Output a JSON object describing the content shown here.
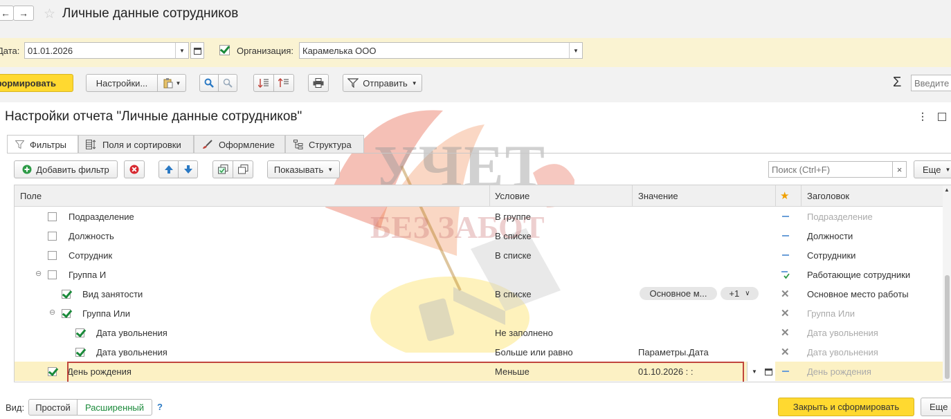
{
  "window": {
    "title": "Личные данные сотрудников"
  },
  "nav": {
    "back": "←",
    "forward": "→"
  },
  "params": {
    "date_label": "Дата:",
    "date_value": "01.01.2026",
    "org_label": "Организация:",
    "org_value": "Карамелька ООО"
  },
  "toolbar": {
    "generate_label": "Сформировать",
    "settings_label": "Настройки...",
    "send_label": "Отправить",
    "sum_symbol": "Σ",
    "input_placeholder": "Введите"
  },
  "settings": {
    "title": "Настройки отчета \"Личные данные сотрудников\"",
    "tabs": [
      {
        "label": "Фильтры"
      },
      {
        "label": "Поля и сортировки"
      },
      {
        "label": "Оформление"
      },
      {
        "label": "Структура"
      }
    ],
    "add_filter_label": "Добавить фильтр",
    "show_label": "Показывать",
    "search_placeholder": "Поиск (Ctrl+F)",
    "more_label": "Еще"
  },
  "table": {
    "headers": {
      "field": "Поле",
      "condition": "Условие",
      "value": "Значение",
      "caption": "Заголовок"
    },
    "rows": [
      {
        "field": "Подразделение",
        "condition": "В группе",
        "value": "",
        "caption": "Подразделение",
        "checked": false,
        "caption_gray": true,
        "marker": "dash"
      },
      {
        "field": "Должность",
        "condition": "В списке",
        "value": "",
        "caption": "Должности",
        "checked": false,
        "caption_gray": false,
        "marker": "dash"
      },
      {
        "field": "Сотрудник",
        "condition": "В списке",
        "value": "",
        "caption": "Сотрудники",
        "checked": false,
        "caption_gray": false,
        "marker": "dash"
      },
      {
        "field": "Группа И",
        "condition": "",
        "value": "",
        "caption": "Работающие сотрудники",
        "checked": false,
        "caption_gray": false,
        "marker": "group"
      },
      {
        "field": "Вид занятости",
        "condition": "В списке",
        "value": "Основное м...",
        "value_extra": "+1",
        "caption": "Основное место работы",
        "checked": true,
        "caption_gray": false,
        "marker": "x"
      },
      {
        "field": "Группа Или",
        "condition": "",
        "value": "",
        "caption": "Группа Или",
        "checked": true,
        "caption_gray": true,
        "marker": "x"
      },
      {
        "field": "Дата увольнения",
        "condition": "Не заполнено",
        "value": "",
        "caption": "Дата увольнения",
        "checked": true,
        "caption_gray": true,
        "marker": "x"
      },
      {
        "field": "Дата увольнения",
        "condition": "Больше или равно",
        "value": "Параметры.Дата",
        "caption": "Дата увольнения",
        "checked": true,
        "caption_gray": true,
        "marker": "x"
      },
      {
        "field": "День рождения",
        "condition": "Меньше",
        "value": "01.10.2026  :  :",
        "caption": "День рождения",
        "checked": true,
        "caption_gray": true,
        "marker": "dash"
      }
    ]
  },
  "footer": {
    "view_label": "Вид:",
    "simple_label": "Простой",
    "extended_label": "Расширенный",
    "help_label": "?",
    "close_generate_label": "Закрыть и сформировать",
    "more_label": "Еще"
  },
  "watermark": {
    "line1": "УЧЕТ",
    "line2": "БЕЗ ЗАБОТ"
  },
  "colors": {
    "accent_yellow": "#ffd930",
    "param_bg": "#faf3d2",
    "highlight_row": "#fcf1c4",
    "red_frame": "#c0453c",
    "green": "#1a8a3a",
    "blue": "#2a79c4"
  }
}
